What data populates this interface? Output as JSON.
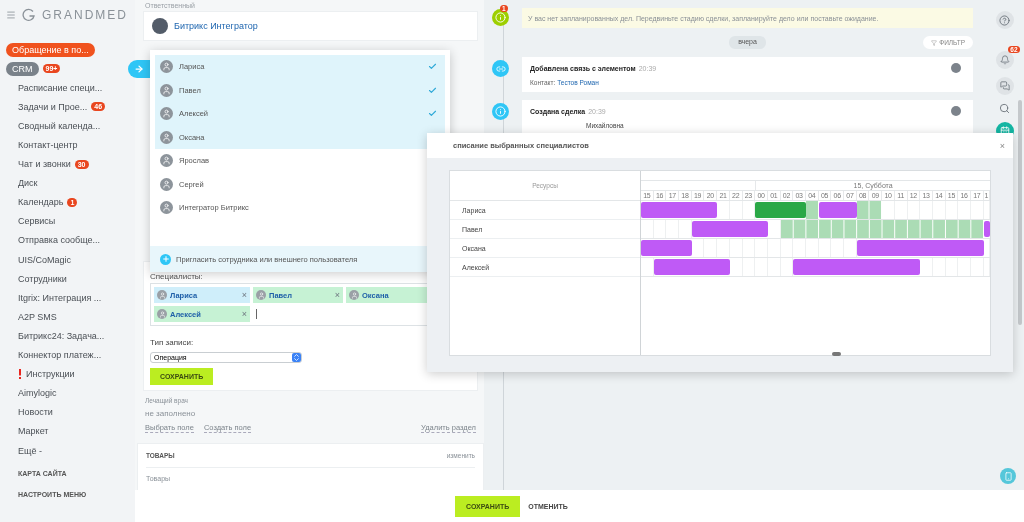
{
  "sidebar": {
    "logo": "GRANDMED",
    "items": [
      {
        "label": "Обращение в по...",
        "kind": "accent"
      },
      {
        "label": "CRM",
        "kind": "current",
        "counter": "99+"
      },
      {
        "label": "Расписание специ...",
        "kind": "plain"
      },
      {
        "label": "Задачи и Прое...",
        "kind": "plain",
        "counter": "46"
      },
      {
        "label": "Сводный календа...",
        "kind": "plain"
      },
      {
        "label": "Контакт-центр",
        "kind": "plain"
      },
      {
        "label": "Чат и звонки",
        "kind": "plain",
        "counter": "30"
      },
      {
        "label": "Диск",
        "kind": "plain"
      },
      {
        "label": "Календарь",
        "kind": "plain",
        "counter": "1"
      },
      {
        "label": "Сервисы",
        "kind": "plain"
      },
      {
        "label": "Отправка сообще...",
        "kind": "plain"
      },
      {
        "label": "UIS/CoMagic",
        "kind": "plain"
      },
      {
        "label": "Сотрудники",
        "kind": "plain"
      },
      {
        "label": "Itgrix: Интеграция ...",
        "kind": "plain"
      },
      {
        "label": "A2P SMS",
        "kind": "plain"
      },
      {
        "label": "Битрикс24: Задача...",
        "kind": "plain"
      },
      {
        "label": "Коннектор платеж...",
        "kind": "plain"
      },
      {
        "label": "Инструкции",
        "kind": "warning"
      },
      {
        "label": "Aimylogic",
        "kind": "plain"
      },
      {
        "label": "Новости",
        "kind": "plain"
      },
      {
        "label": "Маркет",
        "kind": "plain"
      },
      {
        "label": "Ещё -",
        "kind": "plain"
      }
    ],
    "sitemap": "КАРТА САЙТА",
    "configure": "НАСТРОИТЬ МЕНЮ"
  },
  "form": {
    "responsible_label": "Ответственный",
    "responsible": "Битрикс Интегратор",
    "specialists_label": "Специалисты:",
    "tags": [
      {
        "name": "Лариса",
        "selected": true
      },
      {
        "name": "Павел",
        "selected": false
      },
      {
        "name": "Оксана",
        "selected": false
      },
      {
        "name": "Алексей",
        "selected": false
      }
    ],
    "remove_glyph": "×",
    "type_label": "Тип записи:",
    "type_value": "Операция",
    "save": "СОХРАНИТЬ",
    "doctor_label": "Лечащий врач",
    "doctor_value": "не заполнено",
    "links": [
      "Выбрать поле",
      "Создать поле"
    ],
    "delete_link": "Удалить раздел",
    "goods_title": "ТОВАРЫ",
    "goods_edit": "изменить",
    "goods_value": "Товары"
  },
  "picker": {
    "items": [
      {
        "name": "Лариса",
        "selected": true
      },
      {
        "name": "Павел",
        "selected": true
      },
      {
        "name": "Алексей",
        "selected": true
      },
      {
        "name": "Оксана",
        "selected": true
      },
      {
        "name": "Ярослав",
        "selected": false
      },
      {
        "name": "Сергей",
        "selected": false
      },
      {
        "name": "Интегратор Битрикс",
        "selected": false
      }
    ],
    "invite": "Пригласить сотрудника или внешнего пользователя"
  },
  "timeline": {
    "notice": "У вас нет запланированных дел. Передвиньте стадию сделки, запланируйте дело или поставьте ожидание.",
    "notice_counter": "1",
    "day": "вчера",
    "filter": "ФИЛЬТР",
    "events": [
      {
        "kind": "link",
        "title": "Добавлена связь с элементом",
        "time": "20:39",
        "label": "Контакт:",
        "link": "Тестов Роман"
      },
      {
        "kind": "info",
        "title": "Создана сделка",
        "time": "20:39",
        "text": "Михайловна"
      }
    ]
  },
  "rail": {
    "bell_counter": "62"
  },
  "schedule": {
    "title": "списание выбранных специалистов",
    "close": "×",
    "resources_label": "Ресурсы",
    "day_label": "15, Суббота",
    "hours": [
      "15",
      "16",
      "17",
      "18",
      "19",
      "20",
      "21",
      "22",
      "23",
      "00",
      "01",
      "02",
      "03",
      "04",
      "05",
      "06",
      "07",
      "08",
      "09",
      "10",
      "11",
      "12",
      "13",
      "14",
      "15",
      "16",
      "17",
      "1"
    ],
    "rows": [
      {
        "name": "Лариса",
        "slots": [
          {
            "kind": "booked"
          },
          {
            "kind": "booked"
          },
          {
            "kind": "booked"
          },
          {
            "kind": "booked"
          },
          {
            "kind": "booked"
          },
          {
            "kind": "booked"
          },
          {
            "kind": "none"
          },
          {
            "kind": "none"
          },
          {
            "kind": "none"
          },
          {
            "kind": "busy"
          },
          {
            "kind": "busy"
          },
          {
            "kind": "busy"
          },
          {
            "kind": "busy"
          },
          {
            "kind": "free"
          },
          {
            "kind": "booked"
          },
          {
            "kind": "booked"
          },
          {
            "kind": "booked"
          },
          {
            "kind": "free"
          },
          {
            "kind": "free"
          },
          {
            "kind": "none"
          },
          {
            "kind": "none"
          },
          {
            "kind": "none"
          },
          {
            "kind": "none"
          },
          {
            "kind": "none"
          },
          {
            "kind": "none"
          },
          {
            "kind": "none"
          },
          {
            "kind": "none"
          },
          {
            "kind": "none"
          }
        ]
      },
      {
        "name": "Павел",
        "slots": [
          {
            "kind": "none"
          },
          {
            "kind": "none"
          },
          {
            "kind": "none"
          },
          {
            "kind": "none"
          },
          {
            "kind": "booked"
          },
          {
            "kind": "booked"
          },
          {
            "kind": "booked"
          },
          {
            "kind": "booked"
          },
          {
            "kind": "booked"
          },
          {
            "kind": "booked"
          },
          {
            "kind": "none"
          },
          {
            "kind": "free"
          },
          {
            "kind": "free"
          },
          {
            "kind": "free"
          },
          {
            "kind": "free"
          },
          {
            "kind": "free"
          },
          {
            "kind": "free"
          },
          {
            "kind": "free"
          },
          {
            "kind": "free"
          },
          {
            "kind": "free"
          },
          {
            "kind": "free"
          },
          {
            "kind": "free"
          },
          {
            "kind": "free"
          },
          {
            "kind": "free"
          },
          {
            "kind": "free"
          },
          {
            "kind": "free"
          },
          {
            "kind": "free"
          },
          {
            "kind": "booked"
          }
        ]
      },
      {
        "name": "Оксана",
        "slots": [
          {
            "kind": "booked"
          },
          {
            "kind": "booked"
          },
          {
            "kind": "booked"
          },
          {
            "kind": "booked"
          },
          {
            "kind": "none"
          },
          {
            "kind": "none"
          },
          {
            "kind": "none"
          },
          {
            "kind": "none"
          },
          {
            "kind": "none"
          },
          {
            "kind": "none"
          },
          {
            "kind": "none"
          },
          {
            "kind": "none"
          },
          {
            "kind": "none"
          },
          {
            "kind": "none"
          },
          {
            "kind": "none"
          },
          {
            "kind": "none"
          },
          {
            "kind": "none"
          },
          {
            "kind": "booked"
          },
          {
            "kind": "booked"
          },
          {
            "kind": "booked"
          },
          {
            "kind": "booked"
          },
          {
            "kind": "booked"
          },
          {
            "kind": "booked"
          },
          {
            "kind": "booked"
          },
          {
            "kind": "booked"
          },
          {
            "kind": "booked"
          },
          {
            "kind": "booked"
          },
          {
            "kind": "none"
          }
        ]
      },
      {
        "name": "Алексей",
        "slots": [
          {
            "kind": "none"
          },
          {
            "kind": "booked"
          },
          {
            "kind": "booked"
          },
          {
            "kind": "booked"
          },
          {
            "kind": "booked"
          },
          {
            "kind": "booked"
          },
          {
            "kind": "booked"
          },
          {
            "kind": "none"
          },
          {
            "kind": "none"
          },
          {
            "kind": "none"
          },
          {
            "kind": "none"
          },
          {
            "kind": "none"
          },
          {
            "kind": "booked"
          },
          {
            "kind": "booked"
          },
          {
            "kind": "booked"
          },
          {
            "kind": "booked"
          },
          {
            "kind": "booked"
          },
          {
            "kind": "booked"
          },
          {
            "kind": "booked"
          },
          {
            "kind": "booked"
          },
          {
            "kind": "booked"
          },
          {
            "kind": "booked"
          },
          {
            "kind": "none"
          },
          {
            "kind": "none"
          },
          {
            "kind": "none"
          },
          {
            "kind": "none"
          },
          {
            "kind": "none"
          },
          {
            "kind": "none"
          }
        ]
      }
    ]
  },
  "footer": {
    "save": "СОХРАНИТЬ",
    "cancel": "ОТМЕНИТЬ"
  }
}
